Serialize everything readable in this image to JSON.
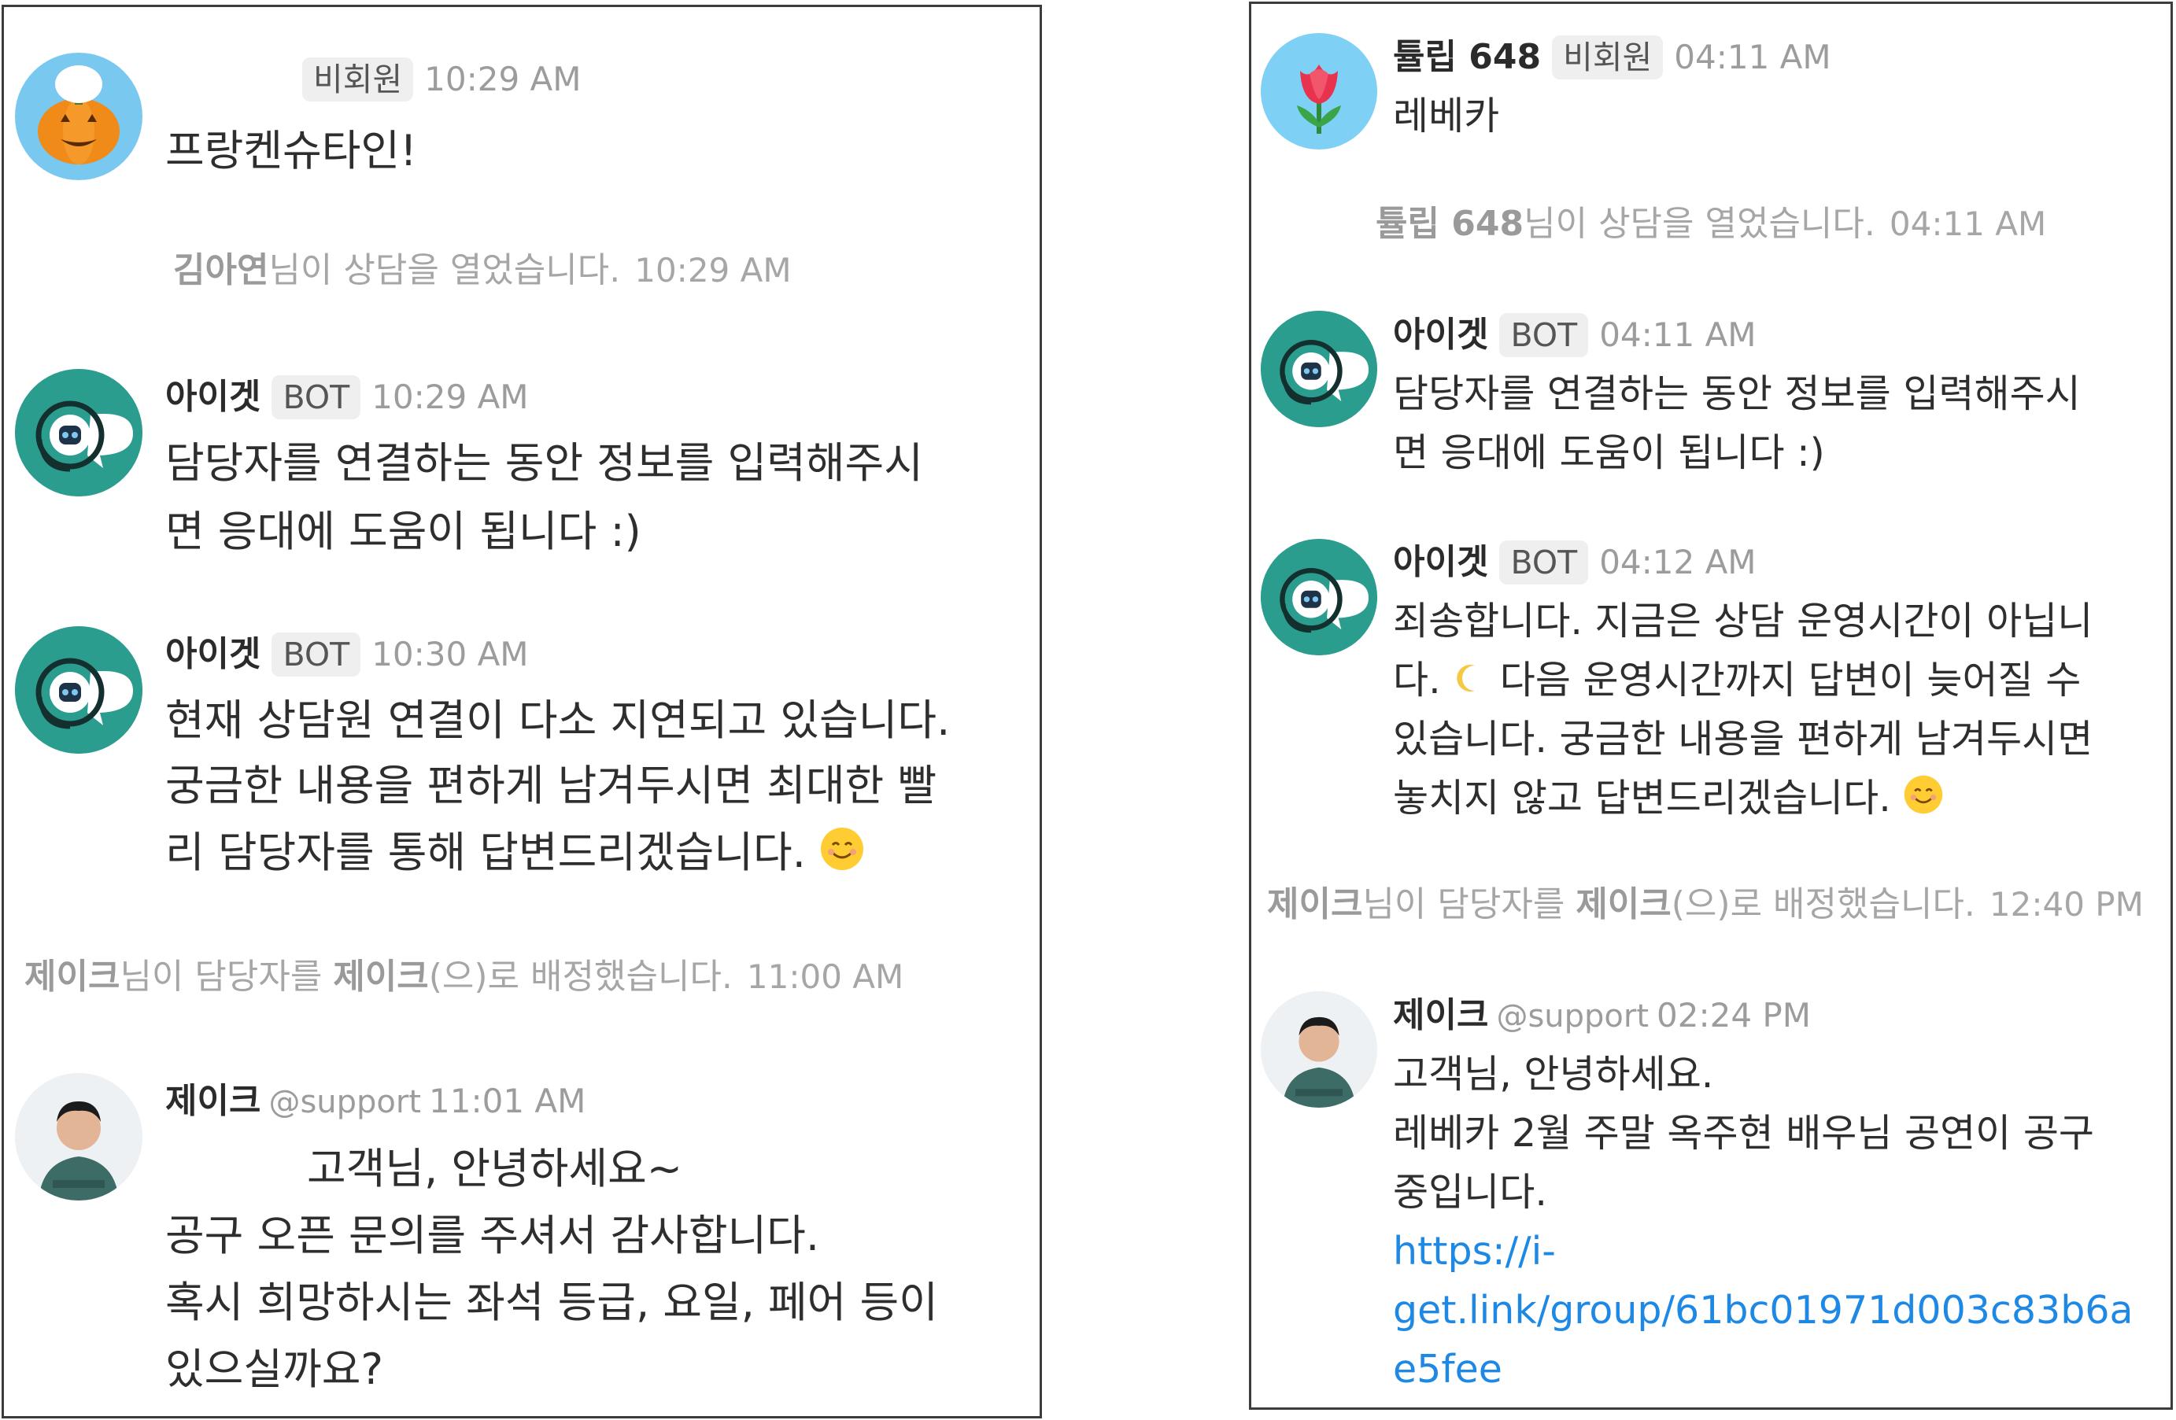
{
  "left": {
    "msg1": {
      "badge": "비회원",
      "time": "10:29 AM",
      "text": "프랑켄슈타인!"
    },
    "sys1": {
      "name": "김아연",
      "action": "님이 상담을 열었습니다.",
      "time": "10:29 AM"
    },
    "bot1": {
      "name": "아이겟",
      "badge": "BOT",
      "time": "10:29 AM",
      "lines": [
        "담당자를 연결하는 동안 정보를 입력해주시",
        "면 응대에 도움이 됩니다 :)"
      ]
    },
    "bot2": {
      "name": "아이겟",
      "badge": "BOT",
      "time": "10:30 AM",
      "lines": [
        "현재 상담원 연결이 다소 지연되고 있습니다.",
        "궁금한 내용을 편하게 남겨두시면 최대한 빨",
        "리 담당자를 통해 답변드리겠습니다."
      ]
    },
    "sys2": {
      "name1": "제이크",
      "mid": "님이 담당자를 ",
      "name2": "제이크",
      "tail": "(으)로 배정했습니다.",
      "time": "11:00 AM"
    },
    "agent": {
      "name": "제이크",
      "handle": "@support",
      "time": "11:01 AM",
      "lines": [
        "고객님, 안녕하세요~",
        "공구 오픈 문의를 주셔서 감사합니다.",
        "혹시 희망하시는 좌석 등급, 요일, 페어 등이",
        "있으실까요?"
      ]
    }
  },
  "right": {
    "msg1": {
      "name": "튤립 648",
      "badge": "비회원",
      "time": "04:11 AM",
      "text": "레베카"
    },
    "sys1": {
      "name": "튤립 648",
      "action": "님이 상담을 열었습니다.",
      "time": "04:11 AM"
    },
    "bot1": {
      "name": "아이겟",
      "badge": "BOT",
      "time": "04:11 AM",
      "lines": [
        "담당자를 연결하는 동안 정보를 입력해주시",
        "면 응대에 도움이 됩니다 :)"
      ]
    },
    "bot2": {
      "name": "아이겟",
      "badge": "BOT",
      "time": "04:12 AM",
      "lines": [
        "죄송합니다. 지금은 상담 운영시간이 아닙니",
        "다 운영시간까지 답변이 늦어질 수",
        "있습니다. 궁금한 내용을 편하게 남겨두시면",
        "놓치지 않고 답변드리겠습니다."
      ]
    },
    "sys2": {
      "name1": "제이크",
      "mid": "님이 담당자를 ",
      "name2": "제이크",
      "tail": "(으)로 배정했습니다.",
      "time": "12:40 PM"
    },
    "agent": {
      "name": "제이크",
      "handle": "@support",
      "time": "02:24 PM",
      "lines": [
        "고객님, 안녕하세요.",
        "레베카 2월 주말 옥주현 배우님 공연이 공구",
        "중입니다."
      ],
      "link_lines": [
        "https://i-",
        "get.link/group/61bc01971d003c83b6a",
        "e5fee"
      ]
    }
  },
  "icons": [
    "pumpkin-icon",
    "tulip-icon",
    "bot-headset-icon",
    "smile-emoji-icon",
    "moon-icon"
  ],
  "colors": {
    "link": "#1e88e5",
    "bot_avatar": "#2a9d8f",
    "pumpkin_avatar": "#79c8ef",
    "tulip_avatar": "#7fd0f5"
  }
}
